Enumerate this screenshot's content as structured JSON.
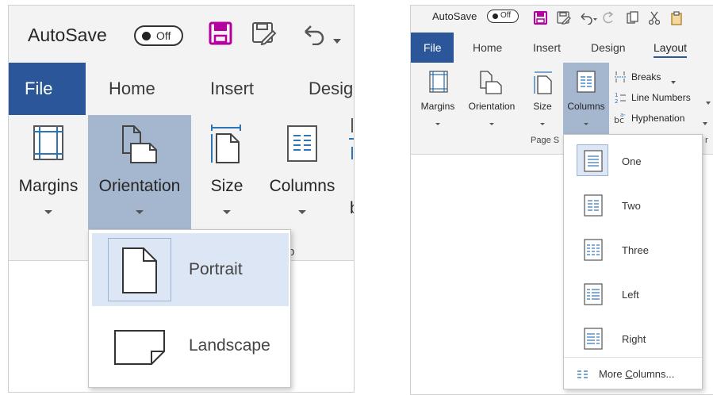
{
  "colors": {
    "file_tab": "#2b579a",
    "active_button": "#a4b7cf",
    "selected_item": "#dce6f4",
    "save_icon": "#b4009e",
    "ribbon_bg": "#f3f3f3"
  },
  "left": {
    "autosave": {
      "label": "AutoSave",
      "state": "Off"
    },
    "tabs": [
      "File",
      "Home",
      "Insert",
      "Desig"
    ],
    "ribbon": {
      "margins": "Margins",
      "orientation": "Orientation",
      "size": "Size",
      "columns": "Columns",
      "clipped": "b"
    },
    "group_label_fragment": "p",
    "orientation_menu": {
      "items": [
        "Portrait",
        "Landscape"
      ],
      "selected": "Portrait"
    },
    "icons": [
      "save-icon",
      "save-as-icon",
      "undo-icon",
      "undo-dropdown-icon"
    ]
  },
  "right": {
    "autosave": {
      "label": "AutoSave",
      "state": "Off"
    },
    "tabs": [
      "File",
      "Home",
      "Insert",
      "Design",
      "Layout"
    ],
    "active_tab": "Layout",
    "ribbon": {
      "margins": "Margins",
      "orientation": "Orientation",
      "size": "Size",
      "columns": "Columns",
      "breaks": "Breaks",
      "line_numbers": "Line Numbers",
      "hyphenation": "Hyphenation"
    },
    "group_label": "Page S",
    "group_label_right": "r",
    "columns_menu": {
      "items": [
        "One",
        "Two",
        "Three",
        "Left",
        "Right"
      ],
      "selected": "One",
      "more_pre": "More ",
      "more_accel": "C",
      "more_post": "olumns..."
    },
    "icons": [
      "save-icon",
      "save-as-icon",
      "undo-icon",
      "redo-icon",
      "copy-icon",
      "cut-icon",
      "paste-icon"
    ]
  }
}
